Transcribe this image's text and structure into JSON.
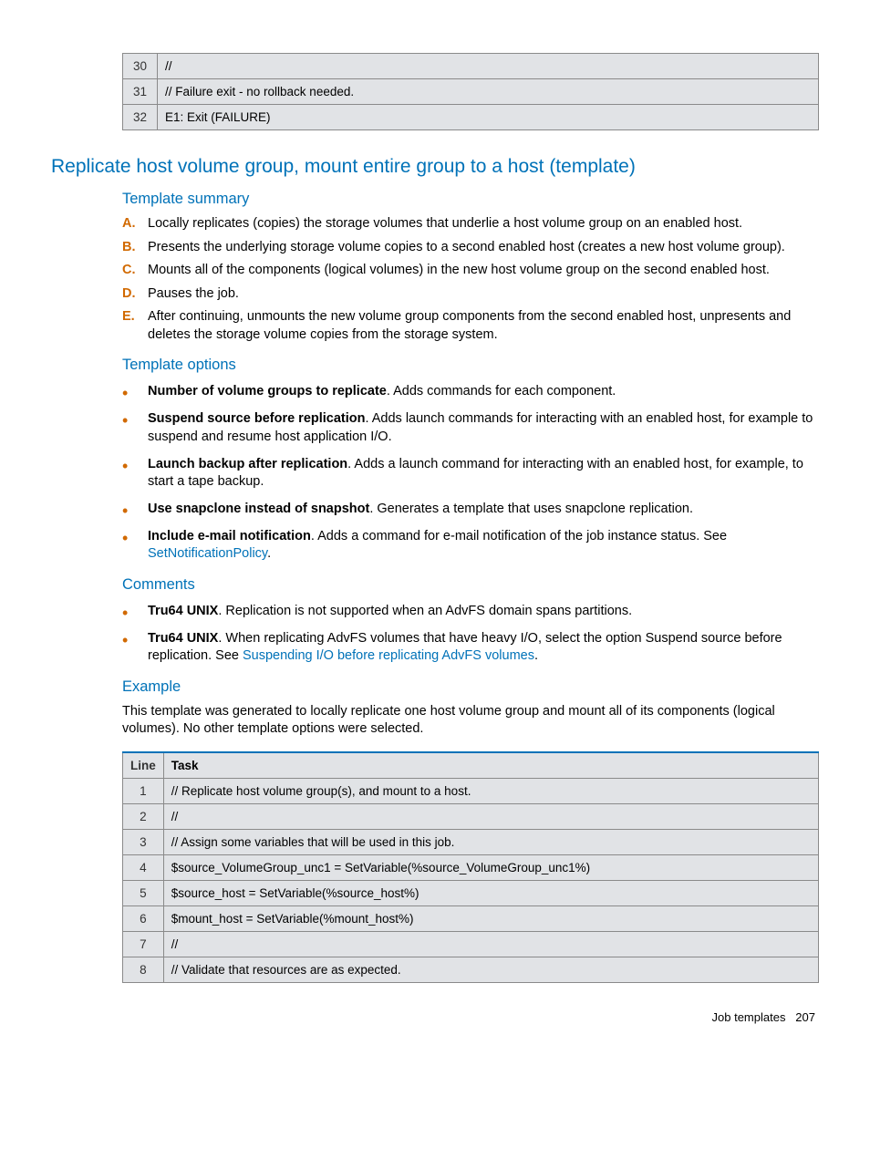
{
  "top_table_rows": [
    {
      "line": "30",
      "task": "//"
    },
    {
      "line": "31",
      "task": "// Failure exit - no rollback needed."
    },
    {
      "line": "32",
      "task": "E1: Exit (FAILURE)"
    }
  ],
  "section_title": "Replicate host volume group, mount entire group to a host (template)",
  "template_summary": {
    "heading": "Template summary",
    "items": [
      {
        "marker": "A.",
        "text": "Locally replicates (copies) the storage volumes that underlie a host volume group on an enabled host."
      },
      {
        "marker": "B.",
        "text": "Presents the underlying storage volume copies to a second enabled host (creates a new host volume group)."
      },
      {
        "marker": "C.",
        "text": "Mounts all of the components (logical volumes) in the new host volume group on the second enabled host."
      },
      {
        "marker": "D.",
        "text": "Pauses the job."
      },
      {
        "marker": "E.",
        "text": "After continuing, unmounts the new volume group components from the second enabled host, unpresents and deletes the storage volume copies from the storage system."
      }
    ]
  },
  "template_options": {
    "heading": "Template options",
    "items": [
      {
        "bold": "Number of volume groups to replicate",
        "rest": ".  Adds commands for each component."
      },
      {
        "bold": "Suspend source before replication",
        "rest": ".  Adds launch commands for interacting with an enabled host, for example to suspend and resume host application I/O."
      },
      {
        "bold": "Launch backup after replication",
        "rest": ".  Adds a launch command for interacting with an enabled host, for example, to start a tape backup."
      },
      {
        "bold": "Use snapclone instead of snapshot",
        "rest": ".  Generates a template that uses snapclone replication."
      },
      {
        "bold": "Include e-mail notification",
        "rest": ".  Adds a command for e-mail notification of the job instance status. See ",
        "link": "SetNotificationPolicy",
        "after_link": "."
      }
    ]
  },
  "comments": {
    "heading": "Comments",
    "items": [
      {
        "bold": "Tru64 UNIX",
        "rest": ". Replication is not supported when an AdvFS domain spans partitions."
      },
      {
        "bold": "Tru64 UNIX",
        "rest": ". When replicating AdvFS volumes that have heavy I/O, select the option Suspend source before replication. See ",
        "link": "Suspending I/O before replicating AdvFS volumes",
        "after_link": "."
      }
    ]
  },
  "example": {
    "heading": "Example",
    "intro": "This template was generated to locally replicate one host volume group and mount all of its components (logical volumes). No other template options were selected.",
    "header_line": "Line",
    "header_task": "Task",
    "rows": [
      {
        "line": "1",
        "task": "// Replicate host volume group(s), and mount to a host."
      },
      {
        "line": "2",
        "task": "//"
      },
      {
        "line": "3",
        "task": "// Assign some variables that will be used in this job."
      },
      {
        "line": "4",
        "task": "$source_VolumeGroup_unc1 = SetVariable(%source_VolumeGroup_unc1%)"
      },
      {
        "line": "5",
        "task": "$source_host = SetVariable(%source_host%)"
      },
      {
        "line": "6",
        "task": "$mount_host = SetVariable(%mount_host%)"
      },
      {
        "line": "7",
        "task": "//"
      },
      {
        "line": "8",
        "task": "// Validate that resources are as expected."
      }
    ]
  },
  "footer": {
    "label": "Job templates",
    "page": "207"
  }
}
